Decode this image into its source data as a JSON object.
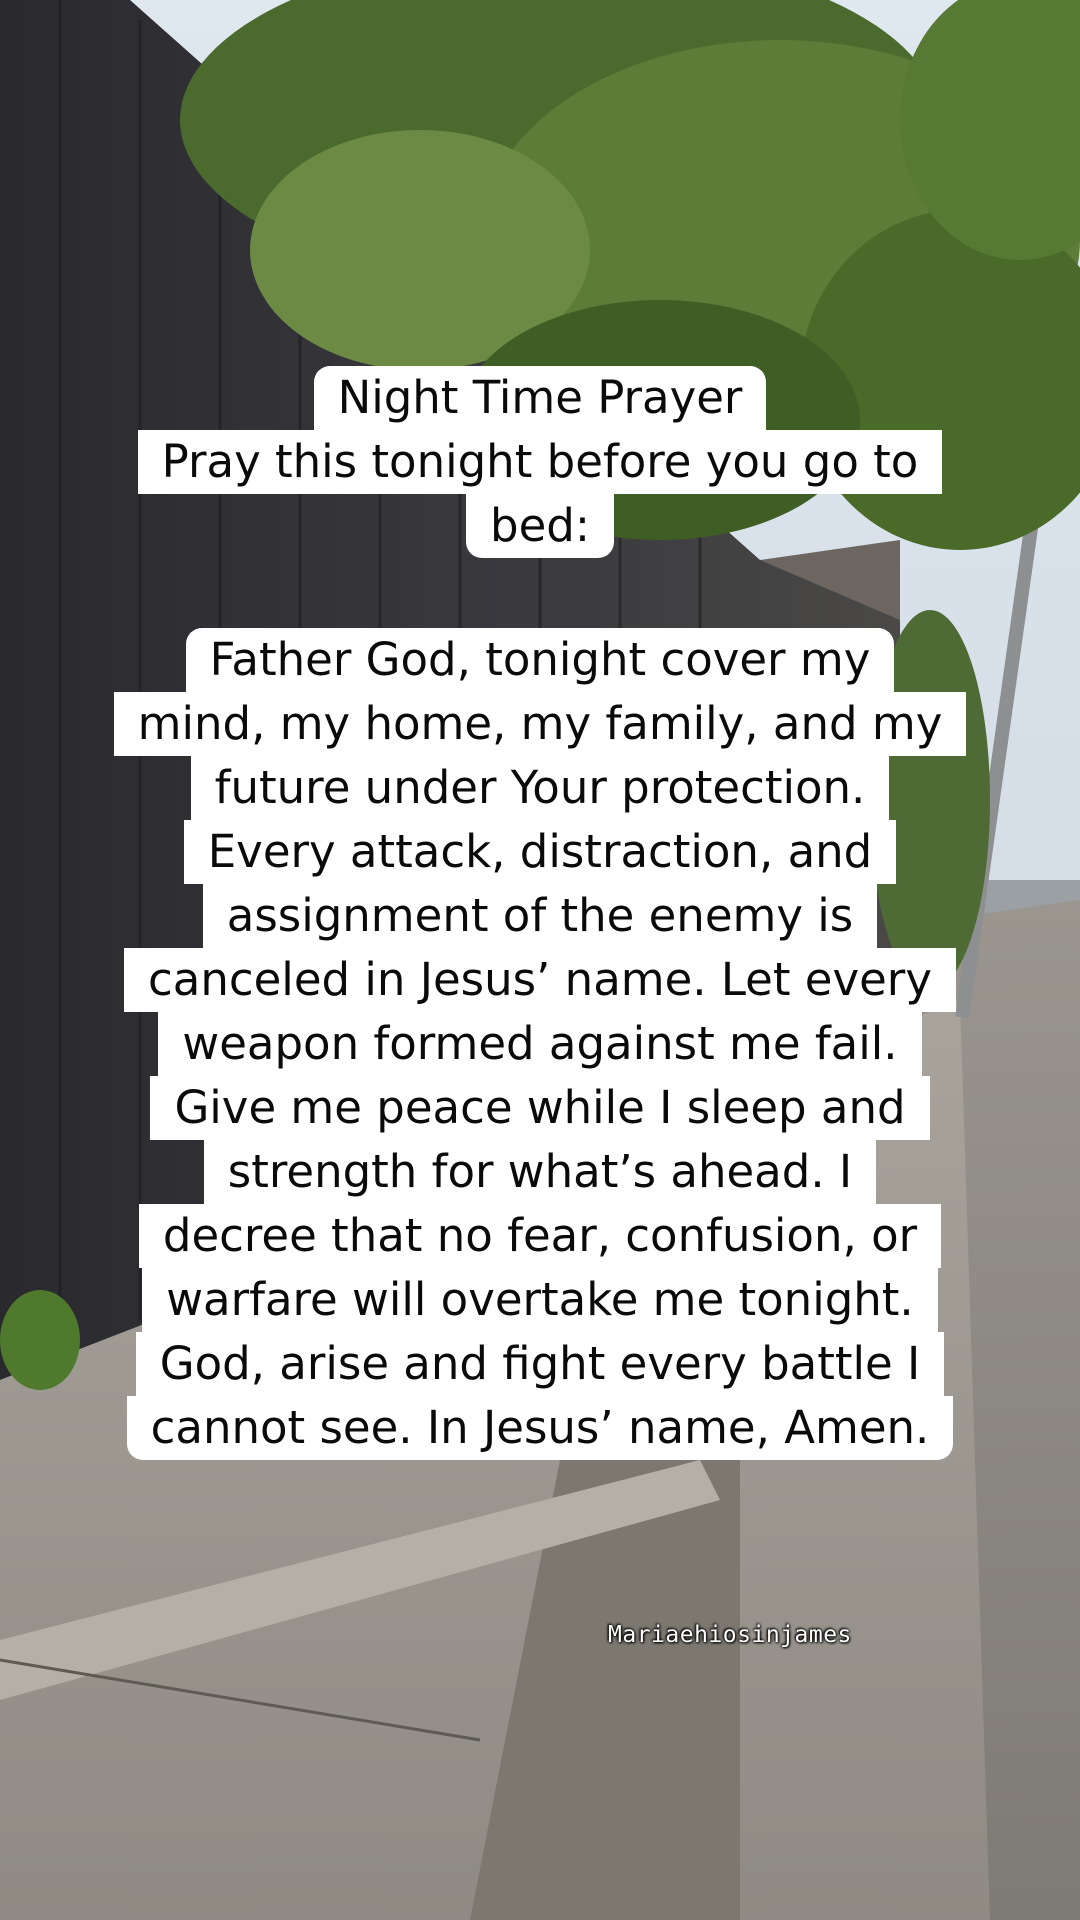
{
  "title_lines": [
    "Night Time Prayer",
    "Pray this tonight before you go to",
    "bed:"
  ],
  "body_lines": [
    "Father God, tonight cover my",
    "mind, my home, my family, and my",
    "future under Your protection.",
    "Every attack, distraction, and",
    "assignment of the enemy is",
    "canceled in Jesus’ name. Let every",
    "weapon formed against me fail.",
    "Give me peace while I sleep and",
    "strength for what’s ahead. I",
    "decree that no fear, confusion, or",
    "warfare will overtake me tonight.",
    "God, arise and fight every battle I",
    "cannot see. In Jesus’ name, Amen."
  ],
  "watermark": "Mariaehiosinjames"
}
